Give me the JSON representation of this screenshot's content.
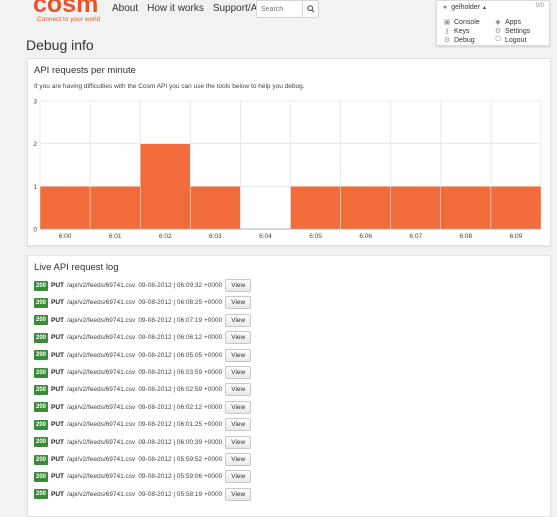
{
  "brand": {
    "name": "cosm",
    "tagline": "Connect to your world",
    "color": "#e8552a"
  },
  "nav": [
    "About",
    "How it works",
    "Support/API"
  ],
  "search": {
    "placeholder": "Search",
    "icon": "search-icon"
  },
  "user_menu": {
    "username": "gelholder",
    "badge": "0/0",
    "items_left": [
      "Console",
      "Keys",
      "Debug"
    ],
    "items_right": [
      "Apps",
      "Settings",
      "Logout"
    ]
  },
  "page_title": "Debug info",
  "api_panel": {
    "title": "API requests per minute",
    "subtitle": "If you are having difficulties with the Cosm API you can use the tools below to help you debug."
  },
  "chart_data": {
    "type": "bar",
    "categories": [
      "6:00",
      "6:01",
      "6:02",
      "6:03",
      "6:04",
      "6:05",
      "6:06",
      "6:07",
      "6:08",
      "6:09"
    ],
    "values": [
      1,
      1,
      2,
      1,
      0,
      1,
      1,
      1,
      1,
      1
    ],
    "ylim": [
      0,
      3
    ],
    "yticks": [
      0,
      1,
      2,
      3
    ],
    "bar_color": "#f26b3a",
    "grid": true
  },
  "log_panel": {
    "title": "Live API request log",
    "view_label": "View",
    "status_color": "#3a8a3a",
    "rows": [
      {
        "status": "200",
        "method": "PUT",
        "path": "/api/v2/feeds/69741.csv",
        "timestamp": "09-08-2012 | 06:09:32 +0000"
      },
      {
        "status": "200",
        "method": "PUT",
        "path": "/api/v2/feeds/69741.csv",
        "timestamp": "09-08-2012 | 06:08:25 +0000"
      },
      {
        "status": "200",
        "method": "PUT",
        "path": "/api/v2/feeds/69741.csv",
        "timestamp": "09-08-2012 | 06:07:19 +0000"
      },
      {
        "status": "200",
        "method": "PUT",
        "path": "/api/v2/feeds/69741.csv",
        "timestamp": "09-08-2012 | 06:06:12 +0000"
      },
      {
        "status": "200",
        "method": "PUT",
        "path": "/api/v2/feeds/69741.csv",
        "timestamp": "09-08-2012 | 06:05:05 +0000"
      },
      {
        "status": "200",
        "method": "PUT",
        "path": "/api/v2/feeds/69741.csv",
        "timestamp": "09-08-2012 | 06:03:59 +0000"
      },
      {
        "status": "200",
        "method": "PUT",
        "path": "/api/v2/feeds/69741.csv",
        "timestamp": "09-08-2012 | 06:02:59 +0000"
      },
      {
        "status": "200",
        "method": "PUT",
        "path": "/api/v2/feeds/69741.csv",
        "timestamp": "09-08-2012 | 06:02:12 +0000"
      },
      {
        "status": "200",
        "method": "PUT",
        "path": "/api/v2/feeds/69741.csv",
        "timestamp": "09-08-2012 | 06:01:25 +0000"
      },
      {
        "status": "200",
        "method": "PUT",
        "path": "/api/v2/feeds/69741.csv",
        "timestamp": "09-08-2012 | 06:00:39 +0000"
      },
      {
        "status": "200",
        "method": "PUT",
        "path": "/api/v2/feeds/69741.csv",
        "timestamp": "09-08-2012 | 05:59:52 +0000"
      },
      {
        "status": "200",
        "method": "PUT",
        "path": "/api/v2/feeds/69741.csv",
        "timestamp": "09-08-2012 | 05:59:06 +0000"
      },
      {
        "status": "200",
        "method": "PUT",
        "path": "/api/v2/feeds/69741.csv",
        "timestamp": "09-08-2012 | 05:58:19 +0000"
      }
    ]
  }
}
